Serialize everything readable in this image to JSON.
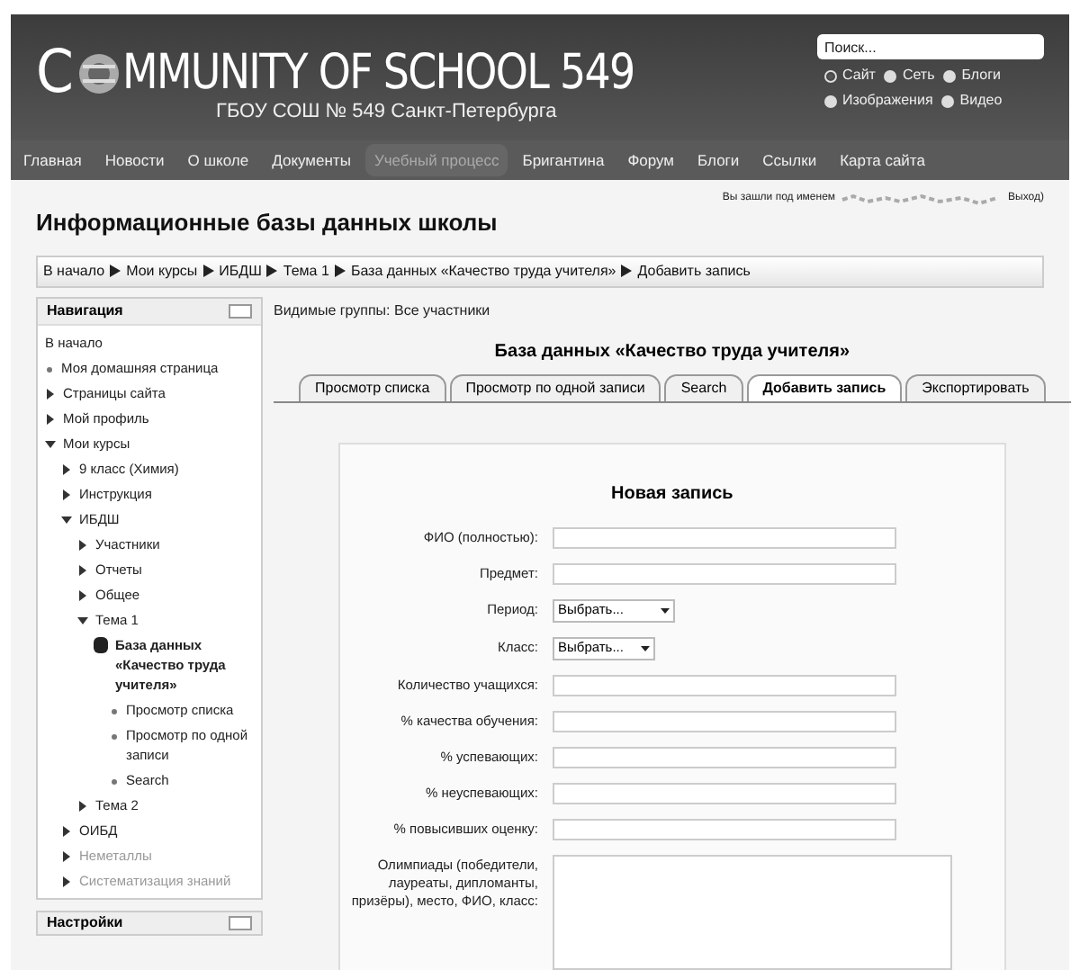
{
  "header": {
    "logo_title": "C",
    "logo_rest": "MMUNITY OF SCHOOL 549",
    "subtitle": "ГБОУ СОШ № 549 Санкт-Петербурга",
    "search": {
      "placeholder": "Поиск..."
    },
    "search_scopes": [
      {
        "label": "Сайт",
        "selected": true
      },
      {
        "label": "Сеть",
        "selected": false
      },
      {
        "label": "Блоги",
        "selected": false
      },
      {
        "label": "Изображения",
        "selected": false
      },
      {
        "label": "Видео",
        "selected": false
      }
    ]
  },
  "menu": [
    {
      "label": "Главная",
      "selected": false
    },
    {
      "label": "Новости",
      "selected": false
    },
    {
      "label": "О школе",
      "selected": false
    },
    {
      "label": "Документы",
      "selected": false
    },
    {
      "label": "Учебный процесс",
      "selected": true
    },
    {
      "label": "Бригантина",
      "selected": false
    },
    {
      "label": "Форум",
      "selected": false
    },
    {
      "label": "Блоги",
      "selected": false
    },
    {
      "label": "Ссылки",
      "selected": false
    },
    {
      "label": "Карта сайта",
      "selected": false
    }
  ],
  "page_title": "Информационные базы данных школы",
  "login": {
    "prefix": "Вы зашли под именем",
    "logout": "Выход)"
  },
  "breadcrumb": [
    "В начало",
    "Мои курсы",
    "ИБДШ",
    "Тема 1",
    "База данных «Качество труда учителя»",
    "Добавить запись"
  ],
  "navigation": {
    "title": "Навигация",
    "items": [
      {
        "label": "В начало",
        "kind": "plain"
      },
      {
        "label": "Моя домашняя страница",
        "kind": "bullet"
      },
      {
        "label": "Страницы сайта",
        "kind": "node",
        "expanded": false
      },
      {
        "label": "Мой профиль",
        "kind": "node",
        "expanded": false
      },
      {
        "label": "Мои курсы",
        "kind": "node",
        "expanded": true,
        "children": [
          {
            "label": "9 класс (Химия)",
            "kind": "node",
            "expanded": false
          },
          {
            "label": "Инструкция",
            "kind": "node",
            "expanded": false
          },
          {
            "label": "ИБДШ",
            "kind": "node",
            "expanded": true,
            "children": [
              {
                "label": "Участники",
                "kind": "node",
                "expanded": false
              },
              {
                "label": "Отчеты",
                "kind": "node",
                "expanded": false
              },
              {
                "label": "Общее",
                "kind": "node",
                "expanded": false
              },
              {
                "label": "Тема 1",
                "kind": "node",
                "expanded": true,
                "children": [
                  {
                    "label": "База данных «Качество труда учителя»",
                    "kind": "database",
                    "children": [
                      {
                        "label": "Просмотр списка",
                        "kind": "bullet"
                      },
                      {
                        "label": "Просмотр по одной записи",
                        "kind": "bullet"
                      },
                      {
                        "label": "Search",
                        "kind": "bullet"
                      }
                    ]
                  }
                ]
              },
              {
                "label": "Тема 2",
                "kind": "node",
                "expanded": false
              }
            ]
          },
          {
            "label": "ОИБД",
            "kind": "node",
            "expanded": false
          },
          {
            "label": "Неметаллы",
            "kind": "node",
            "expanded": false,
            "dimmed": true
          },
          {
            "label": "Систематизация знаний",
            "kind": "node",
            "expanded": false,
            "dimmed": true
          }
        ]
      }
    ]
  },
  "settings_block": {
    "title": "Настройки"
  },
  "groups": "Видимые группы: Все участники",
  "database_title": "База данных «Качество труда учителя»",
  "tabs": [
    {
      "label": "Просмотр списка",
      "selected": false
    },
    {
      "label": "Просмотр по одной записи",
      "selected": false
    },
    {
      "label": "Search",
      "selected": false
    },
    {
      "label": "Добавить запись",
      "selected": true
    },
    {
      "label": "Экспортировать",
      "selected": false
    }
  ],
  "form": {
    "title": "Новая запись",
    "fields": [
      {
        "label": "ФИО (полностью):",
        "kind": "text"
      },
      {
        "label": "Предмет:",
        "kind": "text"
      },
      {
        "label": "Период:",
        "kind": "select",
        "value": "Выбрать...",
        "wide": true
      },
      {
        "label": "Класс:",
        "kind": "select",
        "value": "Выбрать...",
        "wide": false
      },
      {
        "label": "Количество учащихся:",
        "kind": "text"
      },
      {
        "label": "% качества обучения:",
        "kind": "text"
      },
      {
        "label": "% успевающих:",
        "kind": "text"
      },
      {
        "label": "% неуспевающих:",
        "kind": "text"
      },
      {
        "label": "% повысивших оценку:",
        "kind": "text"
      },
      {
        "label": "Олимпиады (победители, лауреаты, дипломанты, призёры), место, ФИО, класс:",
        "kind": "textarea"
      }
    ]
  }
}
